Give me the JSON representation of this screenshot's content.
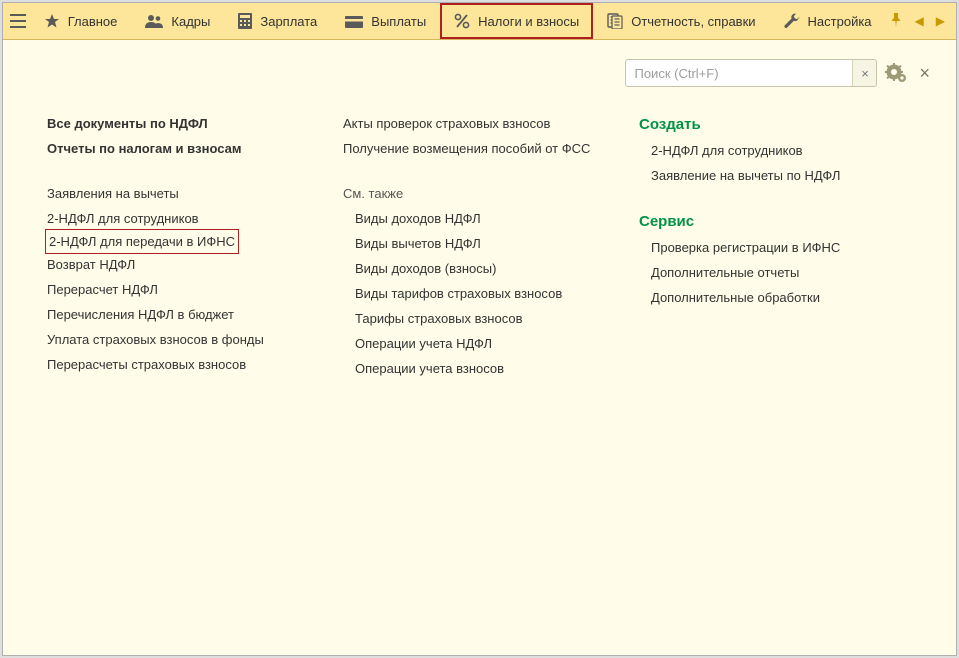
{
  "topbar": {
    "tabs": [
      {
        "label": "Главное"
      },
      {
        "label": "Кадры"
      },
      {
        "label": "Зарплата"
      },
      {
        "label": "Выплаты"
      },
      {
        "label": "Налоги и взносы"
      },
      {
        "label": "Отчетность, справки"
      },
      {
        "label": "Настройка"
      }
    ]
  },
  "search": {
    "placeholder": "Поиск (Ctrl+F)",
    "clear": "×"
  },
  "col1": {
    "h1": "Все документы по НДФЛ",
    "h2": "Отчеты по налогам и взносам",
    "items": [
      "Заявления на вычеты",
      "2-НДФЛ для сотрудников",
      "2-НДФЛ для передачи в ИФНС",
      "Возврат НДФЛ",
      "Перерасчет НДФЛ",
      "Перечисления НДФЛ в бюджет",
      "Уплата страховых взносов в фонды",
      "Перерасчеты страховых взносов"
    ]
  },
  "col2": {
    "top": [
      "Акты проверок страховых взносов",
      "Получение возмещения пособий от ФСС"
    ],
    "seeAlso": "См. также",
    "items": [
      "Виды доходов НДФЛ",
      "Виды вычетов НДФЛ",
      "Виды доходов (взносы)",
      "Виды тарифов страховых взносов",
      "Тарифы страховых взносов",
      "Операции учета НДФЛ",
      "Операции учета взносов"
    ]
  },
  "col3": {
    "create": "Создать",
    "createItems": [
      "2-НДФЛ для сотрудников",
      "Заявление на вычеты по НДФЛ"
    ],
    "service": "Сервис",
    "serviceItems": [
      "Проверка регистрации в ИФНС",
      "Дополнительные отчеты",
      "Дополнительные обработки"
    ]
  }
}
